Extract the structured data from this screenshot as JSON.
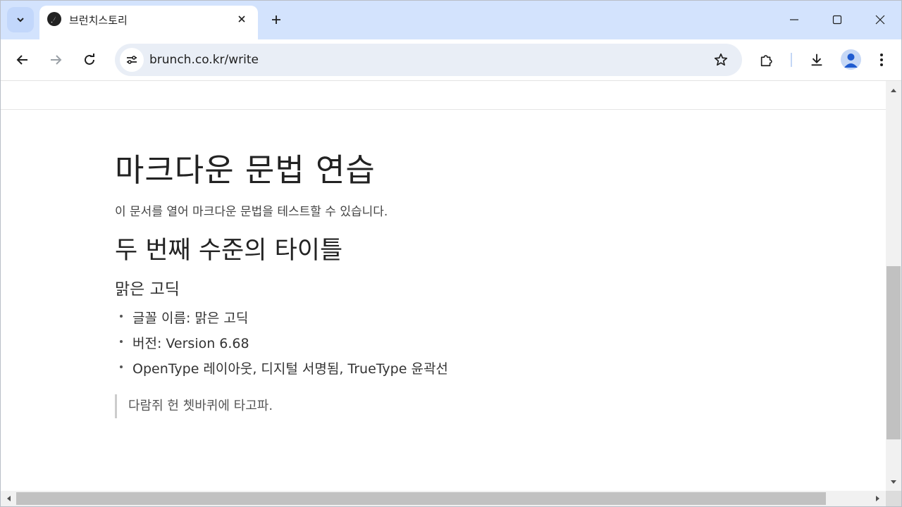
{
  "browser": {
    "tab": {
      "title": "브런치스토리",
      "favicon": "brunch-pen-icon"
    },
    "url": "brunch.co.kr/write",
    "icons": {
      "tab_search": "chevron-down-icon",
      "close_tab": "close-icon",
      "new_tab": "plus-icon",
      "minimize": "minimize-icon",
      "maximize": "maximize-icon",
      "close_window": "close-window-icon",
      "back": "back-arrow-icon",
      "forward": "forward-arrow-icon",
      "reload": "reload-icon",
      "site_info": "tune-icon",
      "bookmark": "star-icon",
      "extensions": "puzzle-icon",
      "downloads": "download-icon",
      "profile": "profile-avatar-icon",
      "menu": "kebab-menu-icon"
    },
    "colors": {
      "tabstrip": "#d3e3fd",
      "omnibox": "#e9eef6",
      "accent": "#1f5bd0"
    }
  },
  "document": {
    "heading1": "마크다운 문법 연습",
    "paragraph": "이 문서를 열어 마크다운 문법을 테스트할 수 있습니다.",
    "heading2": "두 번째 수준의 타이틀",
    "heading3": "맑은 고딕",
    "bullets": [
      "글꼴 이름: 맑은 고딕",
      "버전: Version 6.68",
      "OpenType 레이아웃, 디지털 서명됨, TrueType 윤곽선"
    ],
    "blockquote": "다람쥐 헌 쳇바퀴에 타고파."
  }
}
